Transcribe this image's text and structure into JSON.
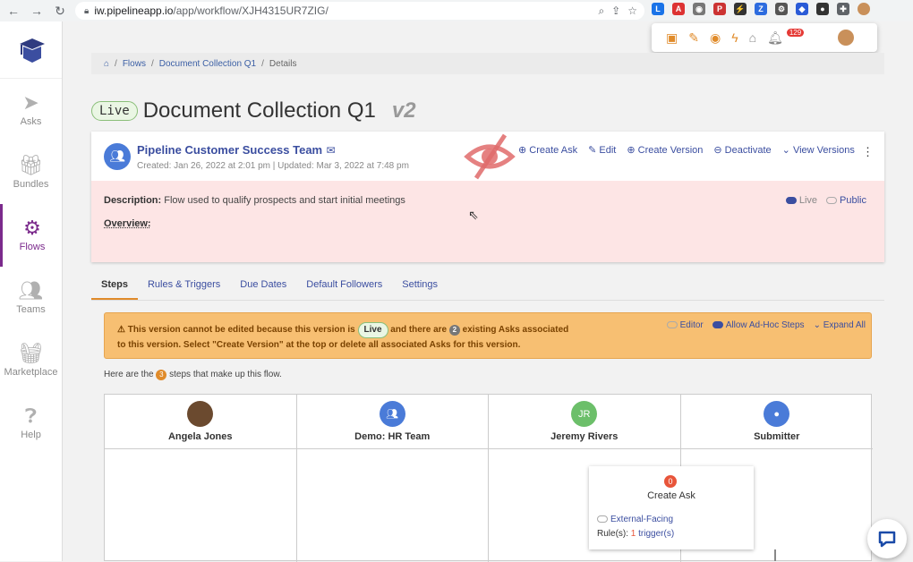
{
  "browser": {
    "url_host": "iw.pipelineapp.io",
    "url_path": "/app/workflow/XJH4315UR7ZIG/"
  },
  "sidebar": {
    "items": [
      {
        "label": "Asks"
      },
      {
        "label": "Bundles"
      },
      {
        "label": "Flows"
      },
      {
        "label": "Teams"
      },
      {
        "label": "Marketplace"
      },
      {
        "label": "Help"
      }
    ]
  },
  "ext_popup": {
    "notif_count": "129"
  },
  "breadcrumb": {
    "flows": "Flows",
    "collection": "Document Collection Q1",
    "details": "Details"
  },
  "header": {
    "status": "Live",
    "title": "Document Collection Q1",
    "version": "v2"
  },
  "card": {
    "team": "Pipeline Customer Success Team",
    "meta": "Created: Jan 26, 2022 at 2:01 pm | Updated: Mar 3, 2022 at 7:48 pm",
    "actions": {
      "create_ask": "Create Ask",
      "edit": "Edit",
      "create_version": "Create Version",
      "deactivate": "Deactivate",
      "view_versions": "View Versions"
    },
    "description_label": "Description:",
    "description": "Flow used to qualify prospects and start initial meetings",
    "overview_label": "Overview:",
    "toggle_live": "Live",
    "toggle_public": "Public"
  },
  "tabs": [
    "Steps",
    "Rules & Triggers",
    "Due Dates",
    "Default Followers",
    "Settings"
  ],
  "warning": {
    "part1": "This version cannot be edited because this version is",
    "pill": "Live",
    "part2": "and there are",
    "count": "2",
    "part3": "existing Asks associated",
    "line2": "to this version. Select \"Create Version\" at the top or delete all associated Asks for this version.",
    "editor": "Editor",
    "adhoc": "Allow Ad-Hoc Steps",
    "expand": "Expand All"
  },
  "steps_intro": {
    "pre": "Here are the",
    "count": "3",
    "post": "steps that make up this flow."
  },
  "columns": [
    {
      "name": "Angela Jones",
      "initials": "",
      "color": "#6b4a2f"
    },
    {
      "name": "Demo: HR Team",
      "initials": "",
      "color": "#4a7bd8"
    },
    {
      "name": "Jeremy Rivers",
      "initials": "JR",
      "color": "#6cbf6a"
    },
    {
      "name": "Submitter",
      "initials": "",
      "color": "#4a7bd8"
    }
  ],
  "step": {
    "count": "0",
    "name": "Create Ask",
    "external": "External-Facing",
    "rules_label": "Rule(s):",
    "rules_count": "1",
    "triggers": "trigger(s)"
  }
}
